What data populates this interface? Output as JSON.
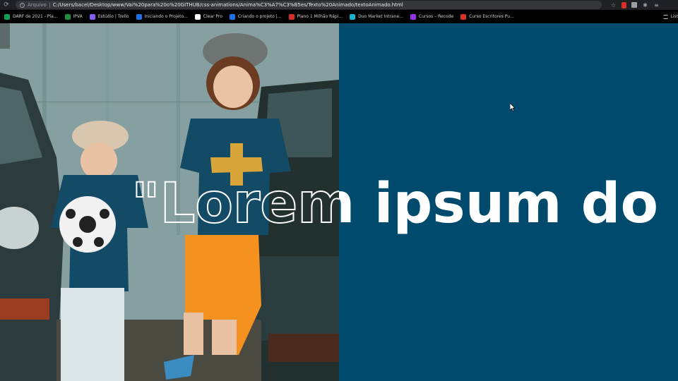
{
  "browser": {
    "file_label": "Arquivo",
    "url": "C:/Users/bacel/Desktop/www/Vai%20para%20o%20GITHUB/css-animations/Anima%C3%A7%C3%B5es/Texto%20Animado/textoAnimado.html",
    "icons": [
      "reload-icon",
      "info-icon",
      "star-icon",
      "extension-icon",
      "puzzle-icon",
      "menu-icon"
    ]
  },
  "bookmarks": [
    {
      "label": "DARF de 2021 - Pla...",
      "color": "#0f9d58"
    },
    {
      "label": "IPVA",
      "color": "#1e8e3e"
    },
    {
      "label": "Estúdio | Trello",
      "color": "#8a5cf6"
    },
    {
      "label": "Iniciando o Projeto...",
      "color": "#1a73e8"
    },
    {
      "label": "Clear Pro",
      "color": "#ffffff"
    },
    {
      "label": "Criando o projeto |...",
      "color": "#1a73e8"
    },
    {
      "label": "Plano 1 Milhão Rápi...",
      "color": "#d93025"
    },
    {
      "label": "Duo Market Intrane...",
      "color": "#12b5cb"
    },
    {
      "label": "Cursos – Recode",
      "color": "#9334e6"
    },
    {
      "label": "Curso Escritores Pu...",
      "color": "#d93025"
    }
  ],
  "bookmarks_list_label": "List",
  "hero": {
    "headline": "\"Lorem ipsum do",
    "panel_color": "#004a6e"
  }
}
